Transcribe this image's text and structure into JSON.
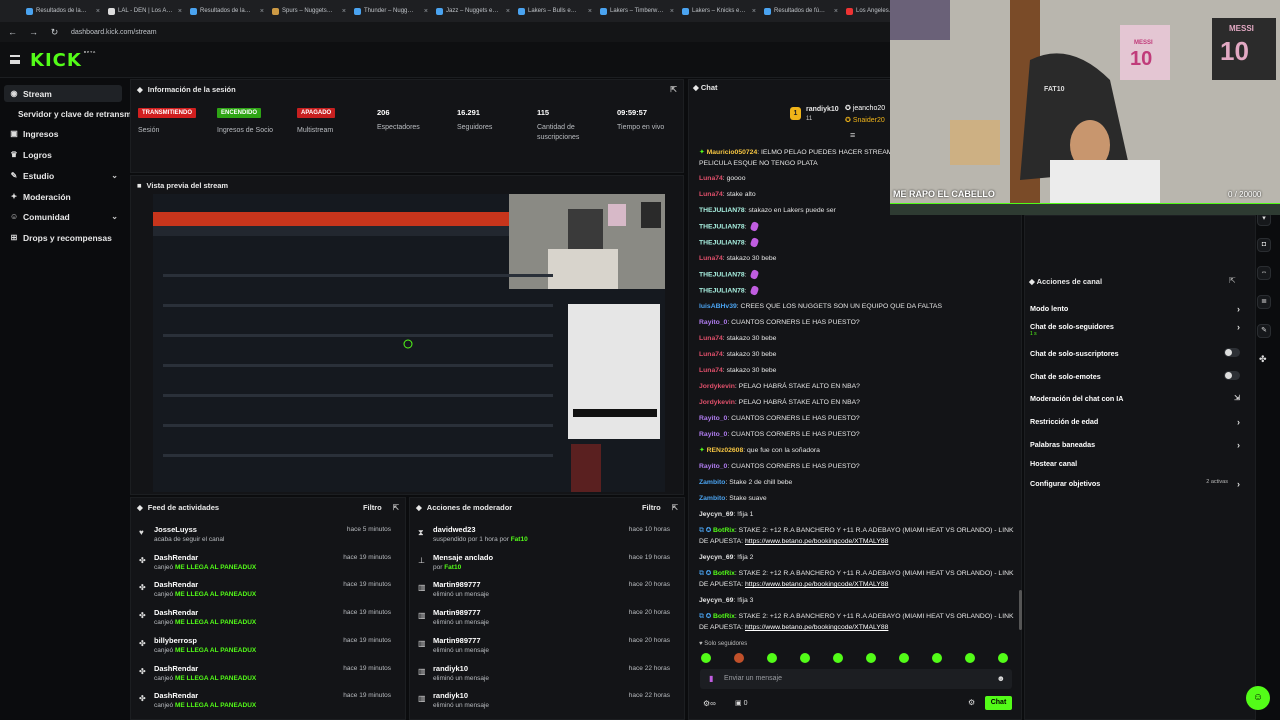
{
  "browser": {
    "tabs": [
      "Resultados de la…",
      "LAL - DEN | Los A…",
      "Resultados de la…",
      "Spurs – Nuggets…",
      "Thunder – Nugg…",
      "Jazz – Nuggets e…",
      "Lakers – Bulls e…",
      "Lakers – Timberw…",
      "Lakers – Knicks e…",
      "Resultados de fú…",
      "Los Angeles…"
    ],
    "url": "dashboard.kick.com/stream"
  },
  "app": {
    "logo": "KICK",
    "logo_beta": "BETA"
  },
  "sidebar": {
    "items": [
      {
        "label": "Stream"
      },
      {
        "label": "Servidor y clave de retransmisión"
      },
      {
        "label": "Ingresos"
      },
      {
        "label": "Logros"
      },
      {
        "label": "Estudio"
      },
      {
        "label": "Moderación"
      },
      {
        "label": "Comunidad"
      },
      {
        "label": "Drops y recompensas"
      }
    ]
  },
  "session": {
    "title": "Información de la sesión",
    "stats": [
      {
        "badge": "TRANSMITIENDO",
        "label": "Sesión",
        "color": "#d11f1f"
      },
      {
        "badge": "ENCENDIDO",
        "label": "Ingresos de Socio",
        "color": "#2ea415"
      },
      {
        "badge": "APAGADO",
        "label": "Multistream",
        "color": "#c72020"
      },
      {
        "value": "206",
        "label": "Espectadores"
      },
      {
        "value": "16.291",
        "label": "Seguidores"
      },
      {
        "value": "115",
        "label": "Cantidad de suscripciones"
      },
      {
        "value": "09:59:57",
        "label": "Tiempo en vivo"
      }
    ]
  },
  "preview": {
    "title": "Vista previa del stream"
  },
  "feed": {
    "title": "Feed de actividades",
    "filter": "Filtro",
    "rows": [
      {
        "name": "JosseLuyss",
        "sub": "acaba de seguir el canal",
        "sub_hl": "",
        "time": "hace 5 minutos",
        "icon": "heart-icon"
      },
      {
        "name": "DashRendar",
        "sub": "canjeó ",
        "sub_hl": "ME LLEGA AL PANEADUX",
        "time": "hace 19 minutos",
        "icon": "reward-icon"
      },
      {
        "name": "DashRendar",
        "sub": "canjeó ",
        "sub_hl": "ME LLEGA AL PANEADUX",
        "time": "hace 19 minutos",
        "icon": "reward-icon"
      },
      {
        "name": "DashRendar",
        "sub": "canjeó ",
        "sub_hl": "ME LLEGA AL PANEADUX",
        "time": "hace 19 minutos",
        "icon": "reward-icon"
      },
      {
        "name": "billyberrosp",
        "sub": "canjeó ",
        "sub_hl": "ME LLEGA AL PANEADUX",
        "time": "hace 19 minutos",
        "icon": "reward-icon"
      },
      {
        "name": "DashRendar",
        "sub": "canjeó ",
        "sub_hl": "ME LLEGA AL PANEADUX",
        "time": "hace 19 minutos",
        "icon": "reward-icon"
      },
      {
        "name": "DashRendar",
        "sub": "canjeó ",
        "sub_hl": "ME LLEGA AL PANEADUX",
        "time": "hace 19 minutos",
        "icon": "reward-icon"
      }
    ]
  },
  "modactions": {
    "title": "Acciones de moderador",
    "filter": "Filtro",
    "rows": [
      {
        "name": "davidwed23",
        "sub": "suspendido por 1 hora por ",
        "sub_hl": "Fat10",
        "time": "hace 10 horas",
        "icon": "hourglass-icon"
      },
      {
        "name": "Mensaje anclado",
        "sub": "por ",
        "sub_hl": "Fat10",
        "time": "hace 19 horas",
        "icon": "pin-icon"
      },
      {
        "name": "Martin989777",
        "sub": "eliminó un mensaje",
        "sub_hl": "",
        "time": "hace 20 horas",
        "icon": "trash-icon"
      },
      {
        "name": "Martin989777",
        "sub": "eliminó un mensaje",
        "sub_hl": "",
        "time": "hace 20 horas",
        "icon": "trash-icon"
      },
      {
        "name": "Martin989777",
        "sub": "eliminó un mensaje",
        "sub_hl": "",
        "time": "hace 20 horas",
        "icon": "trash-icon"
      },
      {
        "name": "randiyk10",
        "sub": "eliminó un mensaje",
        "sub_hl": "",
        "time": "hace 22 horas",
        "icon": "trash-icon"
      },
      {
        "name": "randiyk10",
        "sub": "eliminó un mensaje",
        "sub_hl": "",
        "time": "hace 22 horas",
        "icon": "trash-icon"
      }
    ]
  },
  "chat": {
    "title": "Chat",
    "top_user": "randiyk10",
    "top_count": "11",
    "gifters": [
      "jeancho20",
      "Snaider20"
    ],
    "messages": [
      {
        "user": "Mauricio050724",
        "color": "#f5c542",
        "text": ": IELMO PELAO PUEDES HACER STREAM",
        "badge": true
      },
      {
        "user": "",
        "color": "#fff",
        "text": "PELICULA ESQUE NO TENGO PLATA"
      },
      {
        "user": "Luna74",
        "color": "#e0506b",
        "text": ": goooo"
      },
      {
        "user": "Luna74",
        "color": "#e0506b",
        "text": ": stake alto"
      },
      {
        "user": "THEJULIAN78",
        "color": "#a8f0e0",
        "text": ": stakazo en Lakers puede ser"
      },
      {
        "user": "THEJULIAN78",
        "color": "#a8f0e0",
        "text": ":",
        "emote": true
      },
      {
        "user": "THEJULIAN78",
        "color": "#a8f0e0",
        "text": ":",
        "emote": true
      },
      {
        "user": "Luna74",
        "color": "#e0506b",
        "text": ": stakazo 30 bebe"
      },
      {
        "user": "THEJULIAN78",
        "color": "#a8f0e0",
        "text": ":",
        "emote": true
      },
      {
        "user": "THEJULIAN78",
        "color": "#a8f0e0",
        "text": ":",
        "emote": true
      },
      {
        "user": "luisABHv39",
        "color": "#4aa3f0",
        "text": ": CREES QUE LOS NUGGETS SON UN EQUIPO QUE DA FALTAS"
      },
      {
        "user": "Rayito_0",
        "color": "#b07cf0",
        "text": ": CUANTOS CORNERS LE HAS PUESTO?"
      },
      {
        "user": "Luna74",
        "color": "#e0506b",
        "text": ": stakazo 30 bebe"
      },
      {
        "user": "Luna74",
        "color": "#e0506b",
        "text": ": stakazo 30 bebe"
      },
      {
        "user": "Luna74",
        "color": "#e0506b",
        "text": ": stakazo 30 bebe"
      },
      {
        "user": "Jordykevin",
        "color": "#e0506b",
        "text": ": PELAO HABRÁ STAKE ALTO EN NBA?"
      },
      {
        "user": "Jordykevin",
        "color": "#e0506b",
        "text": ": PELAO HABRÁ STAKE ALTO EN NBA?"
      },
      {
        "user": "Rayito_0",
        "color": "#b07cf0",
        "text": ": CUANTOS CORNERS LE HAS PUESTO?"
      },
      {
        "user": "Rayito_0",
        "color": "#b07cf0",
        "text": ": CUANTOS CORNERS LE HAS PUESTO?"
      },
      {
        "user": "RENz02608",
        "color": "#f5c542",
        "text": ": que fue con la soñadora",
        "badge": true
      },
      {
        "user": "Rayito_0",
        "color": "#b07cf0",
        "text": ": CUANTOS CORNERS LE HAS PUESTO?"
      },
      {
        "user": "Zambito",
        "color": "#4aa3f0",
        "text": ": Stake 2 de chill bebe"
      },
      {
        "user": "Zambito",
        "color": "#4aa3f0",
        "text": ": Stake suave"
      },
      {
        "user": "Jeycyn_69",
        "color": "#e6e6e6",
        "text": ": !fija 1"
      },
      {
        "user": "BotRix",
        "color": "#53fc18",
        "text": ": STAKE 2: +12 R.A BANCHERO Y +11 R.A ADEBAYO (MIAMI HEAT VS ORLANDO) - LINK",
        "bot": true
      },
      {
        "user": "",
        "color": "#fff",
        "text": "DE APUESTA: ",
        "link": "https://www.betano.pe/bookingcode/XTMALY88"
      },
      {
        "user": "Jeycyn_69",
        "color": "#e6e6e6",
        "text": ": !fija 2"
      },
      {
        "user": "BotRix",
        "color": "#53fc18",
        "text": ": STAKE 2: +12 R.A BANCHERO Y +11 R.A ADEBAYO (MIAMI HEAT VS ORLANDO) - LINK",
        "bot": true
      },
      {
        "user": "",
        "color": "#fff",
        "text": "DE APUESTA: ",
        "link": "https://www.betano.pe/bookingcode/XTMALY88"
      },
      {
        "user": "Jeycyn_69",
        "color": "#e6e6e6",
        "text": ": !fija 3"
      },
      {
        "user": "BotRix",
        "color": "#53fc18",
        "text": ": STAKE 2: +12 R.A BANCHERO Y +11 R.A ADEBAYO (MIAMI HEAT VS ORLANDO) - LINK",
        "bot": true
      },
      {
        "user": "",
        "color": "#fff",
        "text": "DE APUESTA: ",
        "link": "https://www.betano.pe/bookingcode/XTMALY88"
      }
    ],
    "followers_only": "Solo seguidores",
    "input_placeholder": "Enviar un mensaje",
    "count": "0",
    "send_label": "Chat"
  },
  "channel_actions": {
    "title": "Acciones de canal",
    "rows": [
      {
        "label": "Modo lento",
        "control": "chevron"
      },
      {
        "label": "Chat de solo-seguidores",
        "control": "chevron",
        "sub": "1 s"
      },
      {
        "label": "Chat de solo-suscriptores",
        "control": "toggle"
      },
      {
        "label": "Chat de solo-emotes",
        "control": "toggle"
      },
      {
        "label": "Moderación del chat con IA",
        "control": "external"
      },
      {
        "label": "Restricción de edad",
        "control": "chevron"
      },
      {
        "label": "Palabras baneadas",
        "control": "chevron"
      },
      {
        "label": "Hostear canal",
        "control": "none"
      },
      {
        "label": "Configurar objetivos",
        "control": "chevron",
        "extra": "2 activas"
      }
    ]
  },
  "overlay": {
    "caption": "ME RAPO EL CABELLO",
    "goal": "0 / 20000",
    "jersey": "MESSI",
    "jersey_num": "10",
    "chair_text": "FAT10"
  },
  "colors": {
    "accent": "#53fc18",
    "bg": "#0b0c0e",
    "panel": "#131417"
  }
}
